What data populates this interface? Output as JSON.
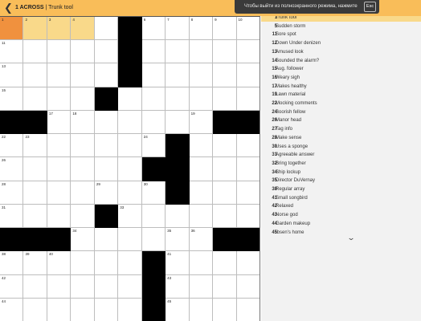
{
  "header": {
    "back_icon": "chevron-left-icon",
    "clue_number": "1 ACROSS",
    "separator": " | ",
    "clue_text": "Trunk tool"
  },
  "fullscreen_notice": {
    "message": "Чтобы выйти из полноэкранного режима, нажмите",
    "key": "Esc"
  },
  "puzzle": {
    "rows": 13,
    "cols": 11,
    "layout": [
      ".....#.....",
      ".....#.....",
      ".....#.....",
      "....#......",
      "##.......##",
      ".......#...",
      "......##...",
      ".......#...",
      "....#......",
      "###......##",
      "......#....",
      "......#....",
      "......#...."
    ],
    "numbers": {
      "0-0": "1",
      "0-1": "2",
      "0-2": "3",
      "0-3": "4",
      "0-5": "5",
      "0-6": "6",
      "0-7": "7",
      "0-8": "8",
      "0-9": "9",
      "0-10": "10",
      "1-0": "11",
      "1-5": "12",
      "2-0": "13",
      "2-5": "14",
      "3-0": "15",
      "3-4": "16",
      "4-2": "17",
      "4-3": "18",
      "4-8": "19",
      "4-9": "20",
      "4-10": "21",
      "5-0": "22",
      "5-1": "23",
      "5-6": "24",
      "5-7": "25",
      "6-0": "26",
      "6-7": "27",
      "7-0": "28",
      "7-4": "29",
      "7-6": "30",
      "8-0": "31",
      "8-4": "32",
      "8-5": "33",
      "9-3": "34",
      "9-7": "35",
      "9-8": "36",
      "9-9": "37",
      "10-0": "38",
      "10-1": "39",
      "10-2": "40",
      "10-7": "41",
      "11-0": "42",
      "11-7": "43",
      "12-0": "44",
      "12-7": "45"
    },
    "active_cell": "0-0",
    "word_cells": [
      "0-1",
      "0-2",
      "0-3"
    ]
  },
  "clues": {
    "active_index": 0,
    "items": [
      {
        "num": "1",
        "text": "Trunk tool"
      },
      {
        "num": "5",
        "text": "Sudden storm"
      },
      {
        "num": "11",
        "text": "Sore spot"
      },
      {
        "num": "12",
        "text": "Down Under denizen"
      },
      {
        "num": "13",
        "text": "Amused look"
      },
      {
        "num": "14",
        "text": "Sounded the alarm?"
      },
      {
        "num": "15",
        "text": "Aug. follower"
      },
      {
        "num": "16",
        "text": "Weary sigh"
      },
      {
        "num": "17",
        "text": "Makes healthy"
      },
      {
        "num": "19",
        "text": "Lawn material"
      },
      {
        "num": "22",
        "text": "Mocking comments"
      },
      {
        "num": "24",
        "text": "Boorish fellow"
      },
      {
        "num": "26",
        "text": "Manor head"
      },
      {
        "num": "27",
        "text": "Tag info"
      },
      {
        "num": "28",
        "text": "Make sense"
      },
      {
        "num": "30",
        "text": "Uses a sponge"
      },
      {
        "num": "31",
        "text": "Agreeable answer"
      },
      {
        "num": "32",
        "text": "Bring together"
      },
      {
        "num": "34",
        "text": "Ship lockup"
      },
      {
        "num": "35",
        "text": "Director DuVernay"
      },
      {
        "num": "38",
        "text": "Regular array"
      },
      {
        "num": "41",
        "text": "Small songbird"
      },
      {
        "num": "42",
        "text": "Relaxed"
      },
      {
        "num": "43",
        "text": "Norse god"
      },
      {
        "num": "44",
        "text": "Garden makeup"
      },
      {
        "num": "45",
        "text": "Ibsen's home"
      }
    ],
    "scroll_icon": "chevron-down-icon"
  }
}
